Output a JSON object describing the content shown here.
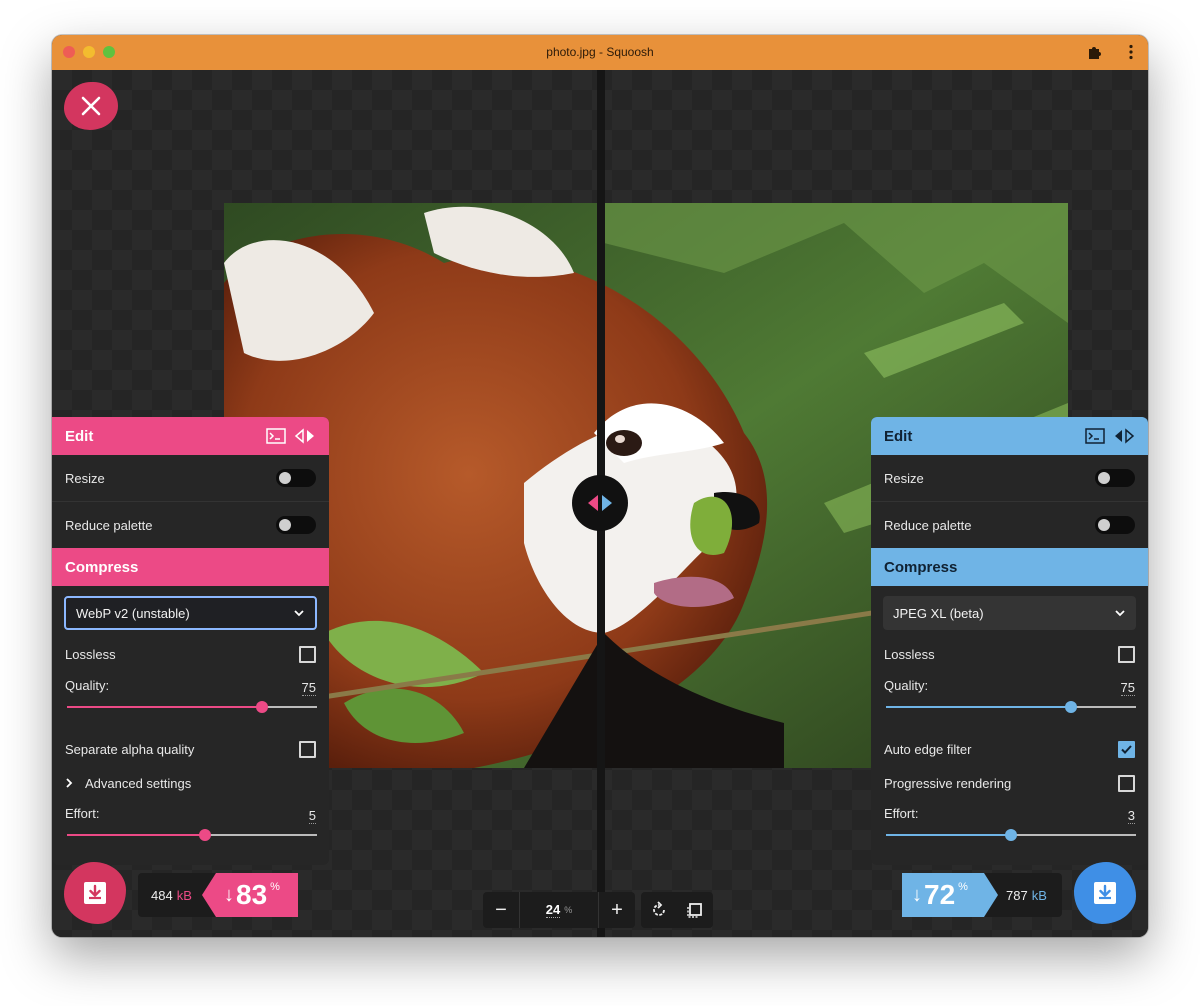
{
  "window": {
    "title": "photo.jpg - Squoosh"
  },
  "colors": {
    "left_accent": "#ec4a86",
    "right_accent": "#6fb4e6",
    "titlebar": "#e8913a"
  },
  "left_panel": {
    "edit_title": "Edit",
    "resize_label": "Resize",
    "resize_on": false,
    "reduce_palette_label": "Reduce palette",
    "reduce_palette_on": false,
    "compress_title": "Compress",
    "codec": "WebP v2 (unstable)",
    "lossless_label": "Lossless",
    "lossless_checked": false,
    "quality_label": "Quality:",
    "quality_value": "75",
    "quality_fraction": 0.78,
    "separate_alpha_label": "Separate alpha quality",
    "separate_alpha_checked": false,
    "advanced_label": "Advanced settings",
    "effort_label": "Effort:",
    "effort_value": "5",
    "effort_fraction": 0.55
  },
  "right_panel": {
    "edit_title": "Edit",
    "resize_label": "Resize",
    "resize_on": false,
    "reduce_palette_label": "Reduce palette",
    "reduce_palette_on": false,
    "compress_title": "Compress",
    "codec": "JPEG XL (beta)",
    "lossless_label": "Lossless",
    "lossless_checked": false,
    "quality_label": "Quality:",
    "quality_value": "75",
    "quality_fraction": 0.74,
    "auto_edge_label": "Auto edge filter",
    "auto_edge_checked": true,
    "progressive_label": "Progressive rendering",
    "progressive_checked": false,
    "effort_label": "Effort:",
    "effort_value": "3",
    "effort_fraction": 0.5
  },
  "left_result": {
    "size": "484",
    "unit": "kB",
    "arrow": "↓",
    "percent": "83",
    "percent_sign": "%"
  },
  "right_result": {
    "size": "787",
    "unit": "kB",
    "arrow": "↓",
    "percent": "72",
    "percent_sign": "%"
  },
  "zoom": {
    "value": "24",
    "unit": "%",
    "minus": "−",
    "plus": "+"
  },
  "icons": {
    "close": "close-icon",
    "download": "download-icon",
    "extension": "puzzle-icon",
    "menu": "kebab-menu-icon",
    "terminal": "terminal-icon",
    "swap": "swap-sides-icon",
    "rotate": "rotate-icon",
    "fit": "fit-to-screen-icon"
  }
}
